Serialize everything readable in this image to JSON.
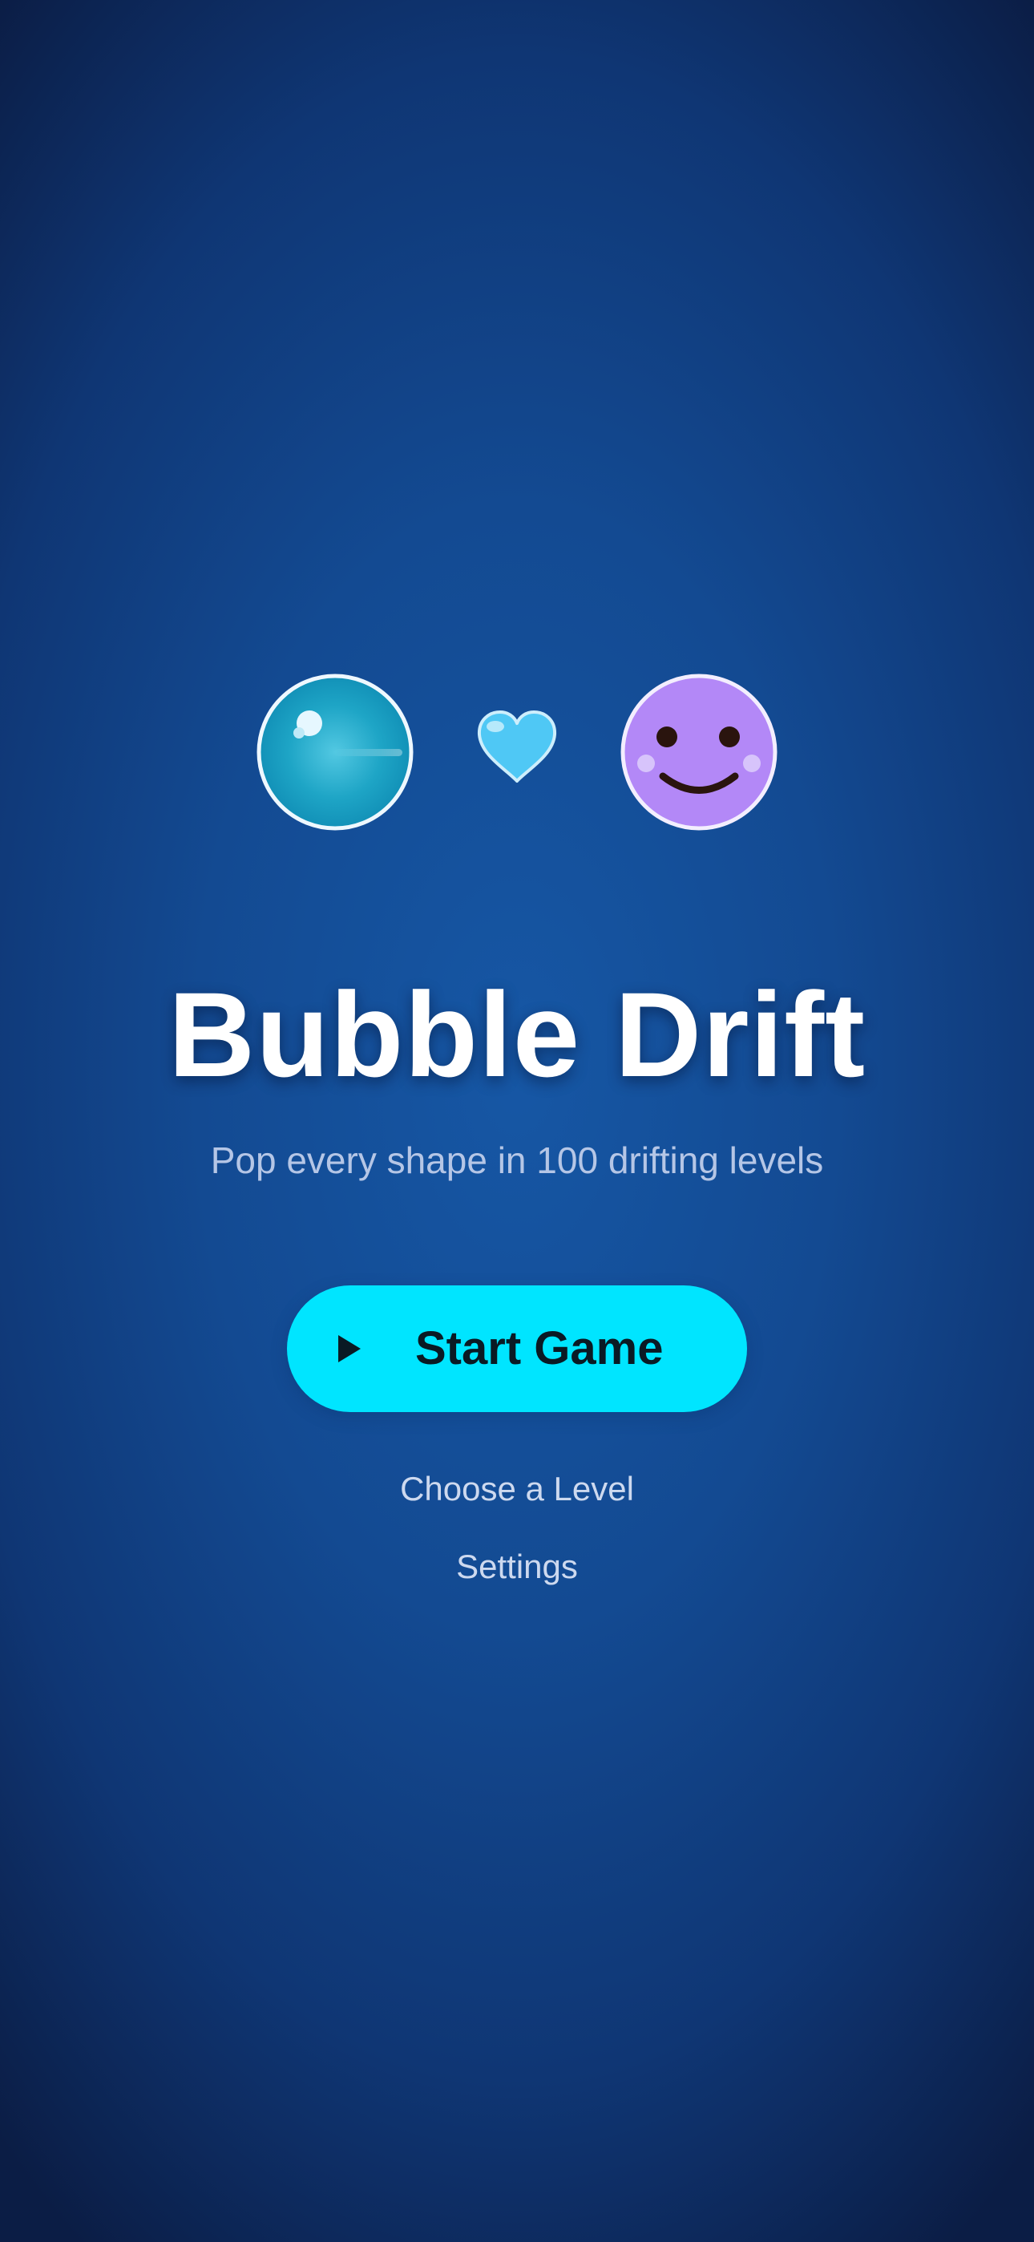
{
  "game": {
    "title": "Bubble Drift",
    "tagline": "Pop every shape in 100 drifting levels"
  },
  "mascots": [
    {
      "icon": "bubble-icon",
      "color": "#1aa3c4"
    },
    {
      "icon": "heart-icon",
      "color": "#4fc8f5"
    },
    {
      "icon": "smiley-icon",
      "color": "#b388f7"
    }
  ],
  "menu": {
    "start_label": "Start Game",
    "start_icon": "play-icon",
    "choose_level_label": "Choose a Level",
    "settings_label": "Settings"
  },
  "colors": {
    "accent": "#00e5ff",
    "background": "#1657a5",
    "title": "#ffffff",
    "subtitle": "#b5c6e6"
  }
}
